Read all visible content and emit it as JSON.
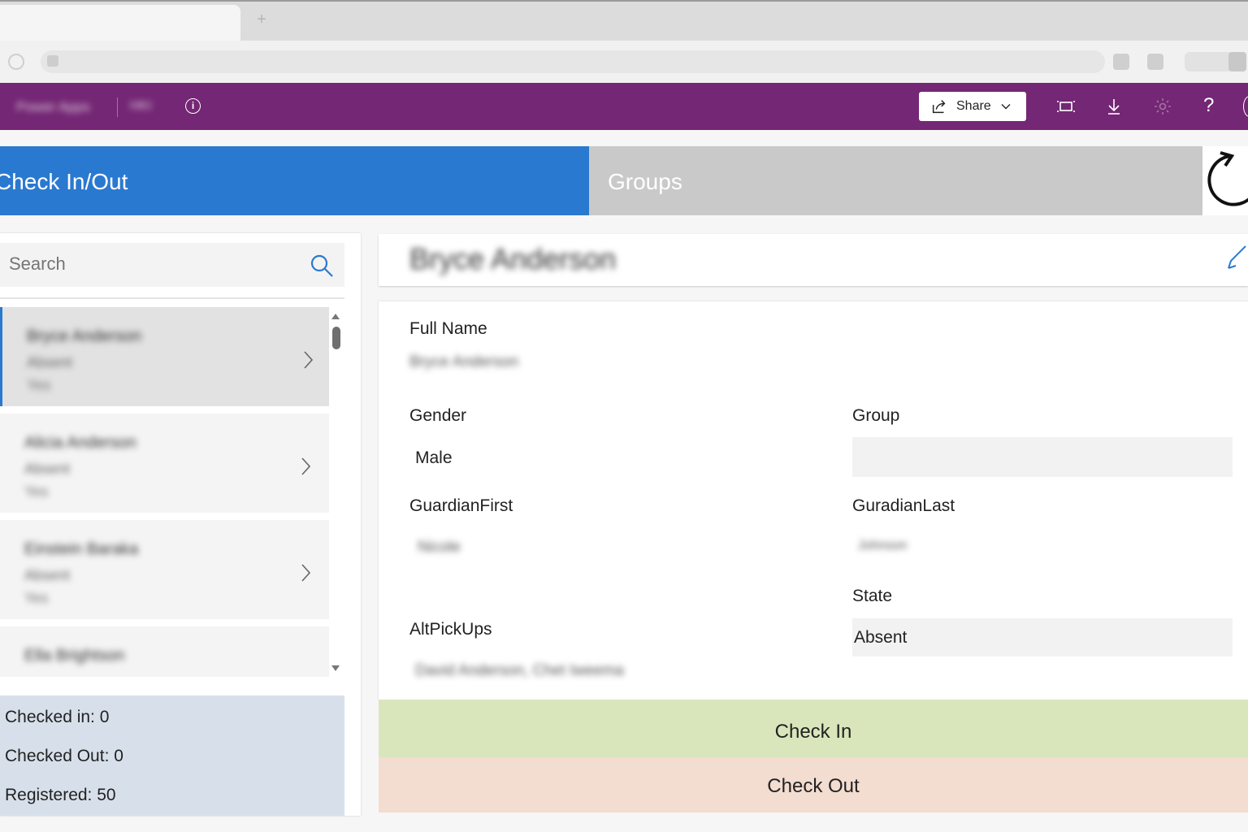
{
  "header": {
    "product": "Power Apps",
    "app_name": "HKI",
    "share_label": "Share",
    "help_glyph": "?",
    "info_glyph": "i",
    "icons": [
      "info-icon",
      "share-icon",
      "chevron-down-icon",
      "fit-screen-icon",
      "download-icon",
      "gear-icon",
      "help-icon"
    ]
  },
  "tabs": {
    "checkin": "Check In/Out",
    "groups": "Groups"
  },
  "search": {
    "placeholder": "Search"
  },
  "list": {
    "items": [
      {
        "name": "Bryce Anderson",
        "status": "Absent",
        "extra": "Yes"
      },
      {
        "name": "Alicia Anderson",
        "status": "Absent",
        "extra": "Yes"
      },
      {
        "name": "Einstein Baraka",
        "status": "Absent",
        "extra": "Yes"
      },
      {
        "name": "Ella Brightson",
        "status": "",
        "extra": ""
      }
    ]
  },
  "stats": {
    "checked_in": "Checked in: 0",
    "checked_out": "Checked Out: 0",
    "registered": "Registered: 50"
  },
  "detail": {
    "title": "Bryce Anderson",
    "labels": {
      "full_name": "Full Name",
      "gender": "Gender",
      "group": "Group",
      "guardian_first": "GuardianFirst",
      "guardian_last": "GuradianLast",
      "state": "State",
      "alt_pickups": "AltPickUps"
    },
    "values": {
      "full_name": "Bryce Anderson",
      "gender": "Male",
      "group": "",
      "guardian_first": "Nicole",
      "guardian_last": "Johnson",
      "state": "Absent",
      "alt_pickups": "David Anderson, Chet Iweema"
    }
  },
  "actions": {
    "check_in": "Check In",
    "check_out": "Check Out"
  },
  "colors": {
    "header_purple": "#742774",
    "tab_active_blue": "#2a79d0",
    "tab_inactive_gray": "#c9c9c9",
    "check_in_green": "#d9e6bc",
    "check_out_salmon": "#f3dcd0",
    "stats_blue": "#d7e0ea"
  }
}
